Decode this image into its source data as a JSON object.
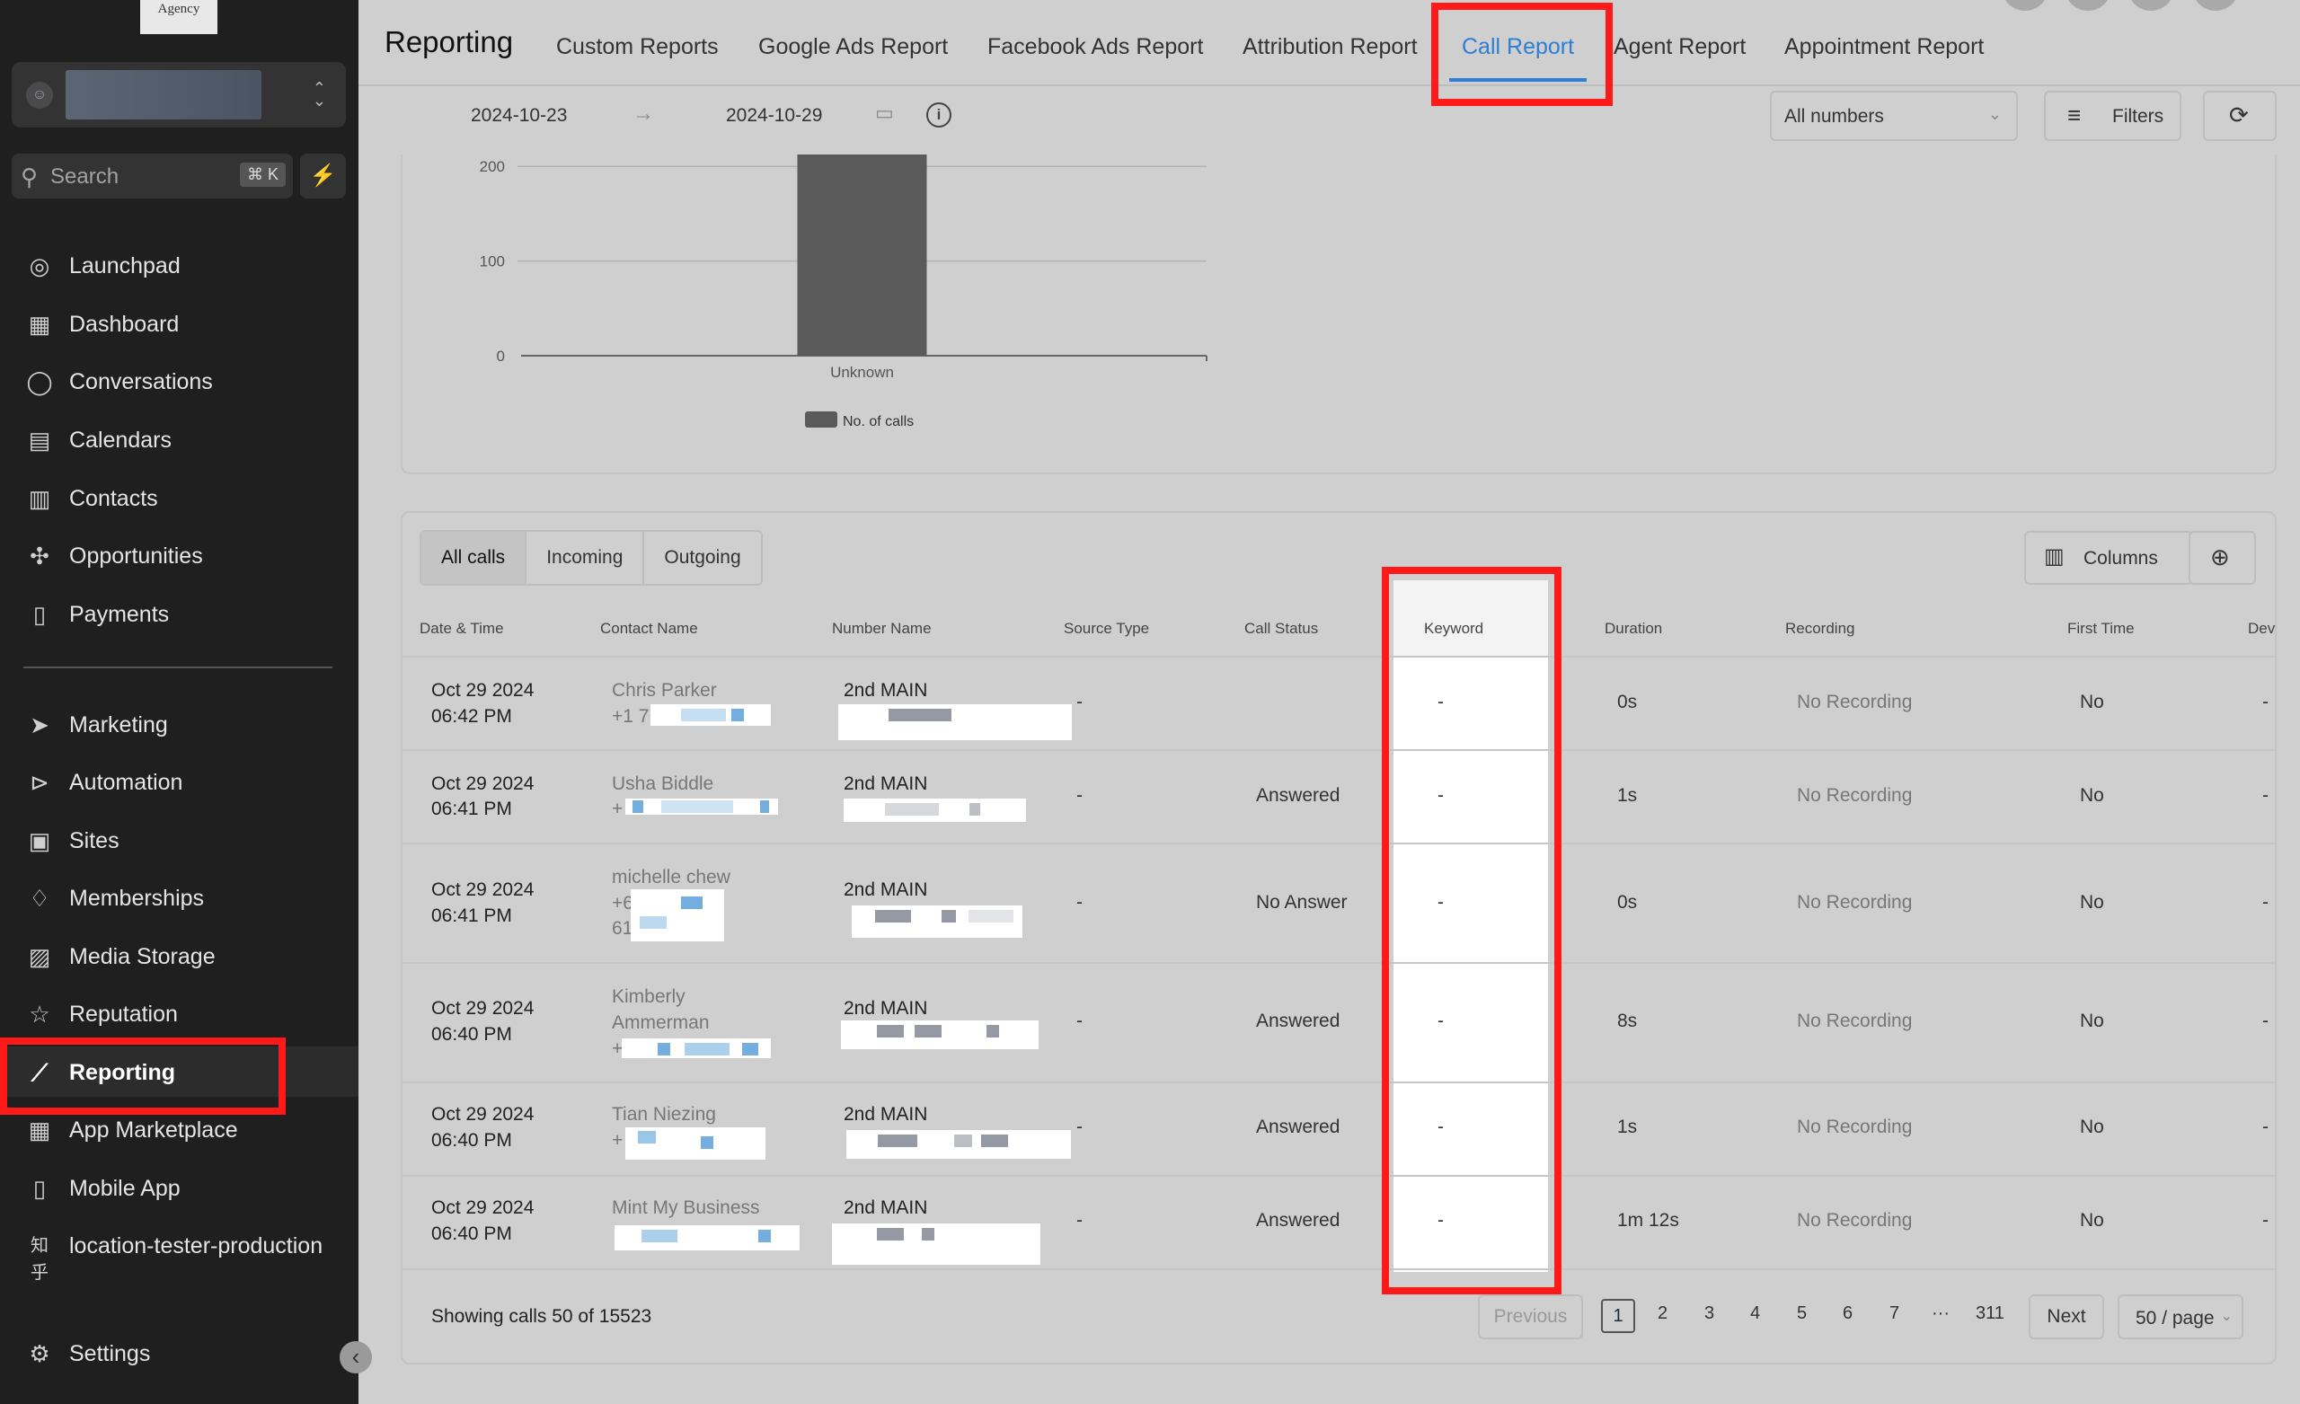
{
  "brand": {
    "logo_text": "Agency"
  },
  "search": {
    "placeholder": "Search",
    "shortcut": "⌘ K"
  },
  "sidebar": {
    "items": [
      {
        "label": "Launchpad",
        "icon": "rocket-icon"
      },
      {
        "label": "Dashboard",
        "icon": "dashboard-icon"
      },
      {
        "label": "Conversations",
        "icon": "chat-icon"
      },
      {
        "label": "Calendars",
        "icon": "calendar-icon"
      },
      {
        "label": "Contacts",
        "icon": "contacts-icon"
      },
      {
        "label": "Opportunities",
        "icon": "opportunities-icon"
      },
      {
        "label": "Payments",
        "icon": "payments-icon"
      },
      {
        "label": "Marketing",
        "icon": "send-icon"
      },
      {
        "label": "Automation",
        "icon": "automation-icon"
      },
      {
        "label": "Sites",
        "icon": "sites-icon"
      },
      {
        "label": "Memberships",
        "icon": "badge-icon"
      },
      {
        "label": "Media Storage",
        "icon": "image-icon"
      },
      {
        "label": "Reputation",
        "icon": "star-icon"
      },
      {
        "label": "Reporting",
        "icon": "trend-icon"
      },
      {
        "label": "App Marketplace",
        "icon": "grid-icon"
      },
      {
        "label": "Mobile App",
        "icon": "phone-icon"
      },
      {
        "label": "location-tester-production",
        "icon": "zhihu-icon"
      },
      {
        "label": "Settings",
        "icon": "gear-icon"
      }
    ],
    "active": "Reporting"
  },
  "header": {
    "title": "Reporting",
    "tabs": [
      "Custom Reports",
      "Google Ads Report",
      "Facebook Ads Report",
      "Attribution Report",
      "Call Report",
      "Agent Report",
      "Appointment Report"
    ],
    "active_tab": "Call Report"
  },
  "filters": {
    "start_date": "2024-10-23",
    "end_date": "2024-10-29",
    "numbers": "All numbers",
    "filters_label": "Filters"
  },
  "chart_data": {
    "type": "bar",
    "categories": [
      "Unknown"
    ],
    "series": [
      {
        "name": "No. of calls",
        "values": [
          222
        ]
      }
    ],
    "yticks": [
      0,
      100,
      200
    ],
    "ylim": [
      0,
      222
    ],
    "legend": "bottom-center"
  },
  "table": {
    "segments": [
      "All calls",
      "Incoming",
      "Outgoing"
    ],
    "active_segment": "All calls",
    "columns_label": "Columns",
    "headers": [
      "Date & Time",
      "Contact Name",
      "Number Name",
      "Source Type",
      "Call Status",
      "Keyword",
      "Duration",
      "Recording",
      "First Time",
      "Dev"
    ],
    "rows": [
      {
        "date": "Oct 29 2024",
        "time": "06:42 PM",
        "contact": "Chris Parker",
        "contact2": "+1 7",
        "number": "2nd MAIN",
        "source": "-",
        "status": "",
        "keyword": "-",
        "duration": "0s",
        "recording": "No Recording",
        "first": "No",
        "dev": "-"
      },
      {
        "date": "Oct 29 2024",
        "time": "06:41 PM",
        "contact": "Usha Biddle",
        "contact2": "+",
        "number": "2nd MAIN",
        "source": "-",
        "status": "Answered",
        "keyword": "-",
        "duration": "1s",
        "recording": "No Recording",
        "first": "No",
        "dev": "-"
      },
      {
        "date": "Oct 29 2024",
        "time": "06:41 PM",
        "contact": "michelle chew",
        "contact2": "+6",
        "contact3": "61",
        "number": "2nd MAIN",
        "source": "-",
        "status": "No Answer",
        "keyword": "-",
        "duration": "0s",
        "recording": "No Recording",
        "first": "No",
        "dev": "-"
      },
      {
        "date": "Oct 29 2024",
        "time": "06:40 PM",
        "contact": "Kimberly",
        "contact_b": "Ammerman",
        "contact2": "+",
        "number": "2nd MAIN",
        "source": "-",
        "status": "Answered",
        "keyword": "-",
        "duration": "8s",
        "recording": "No Recording",
        "first": "No",
        "dev": "-"
      },
      {
        "date": "Oct 29 2024",
        "time": "06:40 PM",
        "contact": "Tian Niezing",
        "contact2": "+",
        "number": "2nd MAIN",
        "source": "-",
        "status": "Answered",
        "keyword": "-",
        "duration": "1s",
        "recording": "No Recording",
        "first": "No",
        "dev": "-"
      },
      {
        "date": "Oct 29 2024",
        "time": "06:40 PM",
        "contact": "Mint My Business",
        "contact2": "",
        "number": "2nd MAIN",
        "source": "-",
        "status": "Answered",
        "keyword": "-",
        "duration": "1m 12s",
        "recording": "No Recording",
        "first": "No",
        "dev": "-"
      }
    ]
  },
  "pagination": {
    "summary": "Showing calls 50 of 15523",
    "previous": "Previous",
    "pages": [
      "1",
      "2",
      "3",
      "4",
      "5",
      "6",
      "7",
      "···",
      "311"
    ],
    "current": "1",
    "next": "Next",
    "page_size": "50 / page"
  },
  "colors": {
    "accent": "#2b7fd5",
    "highlight": "#ff1a1a",
    "bar": "#5a5a5a",
    "sidebar": "#1f1f1f"
  }
}
